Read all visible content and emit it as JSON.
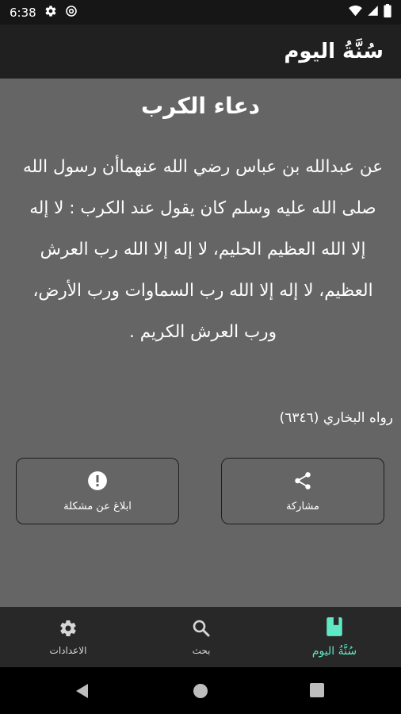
{
  "status_bar": {
    "time": "6:38",
    "icons": [
      "gear-icon",
      "at-icon",
      "wifi-icon",
      "signal-icon",
      "battery-icon"
    ]
  },
  "app_bar": {
    "title": "سُنَّةُ اليوم"
  },
  "card": {
    "title": "دعاء الكرب",
    "text": "عن عبدالله بن عباس رضي الله عنهماأن رسول الله صلى الله عليه وسلم كان يقول عند الكرب : لا إله إلا الله العظيم الحليم، لا إله إلا الله رب العرش العظيم، لا إله إلا الله رب السماوات ورب الأرض، ورب العرش الكريم .",
    "reference": "رواه البخاري (٦٣٤٦)"
  },
  "actions": {
    "share_label": "مشاركة",
    "report_label": "ابلاغ عن مشكلة"
  },
  "bottom_nav": {
    "items": [
      {
        "label": "سُنَّةُ اليوم",
        "icon": "book-icon",
        "active": true
      },
      {
        "label": "بحث",
        "icon": "search-icon",
        "active": false
      },
      {
        "label": "الاعدادات",
        "icon": "gear-icon",
        "active": false
      }
    ],
    "active_color": "#5fe8c4"
  },
  "colors": {
    "status_bar": "#161616",
    "app_bar": "#202020",
    "content": "#656565",
    "bottom_nav": "#282828"
  }
}
